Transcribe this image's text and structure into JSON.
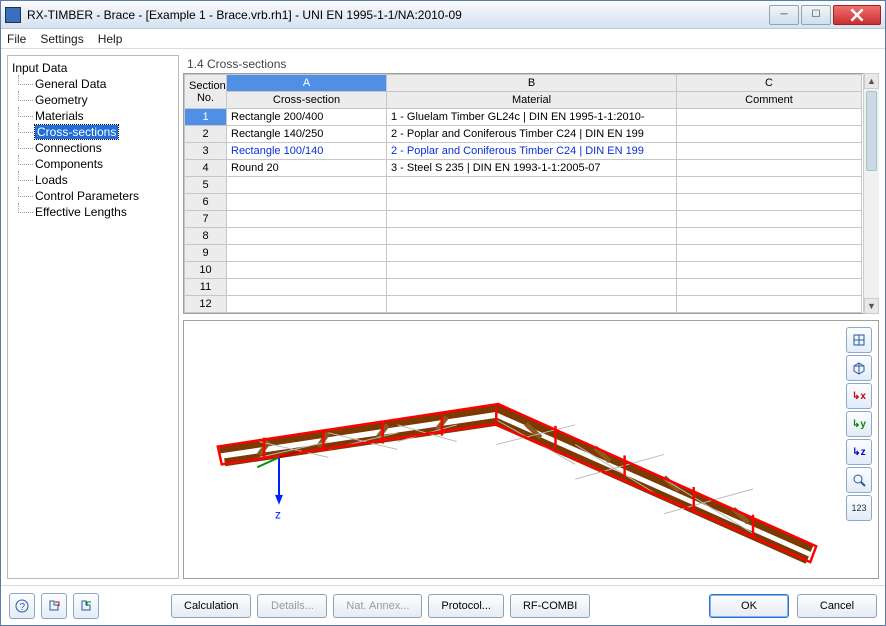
{
  "window": {
    "title": "RX-TIMBER - Brace - [Example 1 - Brace.vrb.rh1] - UNI EN 1995-1-1/NA:2010-09"
  },
  "menu": {
    "file": "File",
    "settings": "Settings",
    "help": "Help"
  },
  "tree": {
    "root": "Input Data",
    "items": [
      {
        "label": "General Data"
      },
      {
        "label": "Geometry"
      },
      {
        "label": "Materials"
      },
      {
        "label": "Cross-sections",
        "selected": true
      },
      {
        "label": "Connections"
      },
      {
        "label": "Components"
      },
      {
        "label": "Loads"
      },
      {
        "label": "Control Parameters"
      },
      {
        "label": "Effective Lengths"
      }
    ]
  },
  "panel": {
    "title": "1.4 Cross-sections"
  },
  "grid": {
    "letters": [
      "A",
      "B",
      "C"
    ],
    "section_no_header": "Section\nNo.",
    "col_headers": [
      "Cross-section",
      "Material",
      "Comment"
    ],
    "rows": [
      {
        "n": "1",
        "selected": true,
        "a": "Rectangle 200/400",
        "b": "1 - Gluelam Timber GL24c | DIN EN 1995-1-1:2010-",
        "c": ""
      },
      {
        "n": "2",
        "a": "Rectangle 140/250",
        "b": "2 - Poplar and Coniferous Timber C24 | DIN EN 199",
        "c": ""
      },
      {
        "n": "3",
        "blue": true,
        "a": "Rectangle 100/140",
        "b": "2 - Poplar and Coniferous Timber C24 | DIN EN 199",
        "c": ""
      },
      {
        "n": "4",
        "a": "Round 20",
        "b": "3 - Steel S 235 | DIN EN 1993-1-1:2005-07",
        "c": ""
      },
      {
        "n": "5",
        "a": "",
        "b": "",
        "c": ""
      },
      {
        "n": "6",
        "a": "",
        "b": "",
        "c": ""
      },
      {
        "n": "7",
        "a": "",
        "b": "",
        "c": ""
      },
      {
        "n": "8",
        "a": "",
        "b": "",
        "c": ""
      },
      {
        "n": "9",
        "a": "",
        "b": "",
        "c": ""
      },
      {
        "n": "10",
        "a": "",
        "b": "",
        "c": ""
      },
      {
        "n": "11",
        "a": "",
        "b": "",
        "c": ""
      },
      {
        "n": "12",
        "a": "",
        "b": "",
        "c": ""
      }
    ]
  },
  "viewer": {
    "axis_z": "z"
  },
  "buttons": {
    "calculation": "Calculation",
    "details": "Details...",
    "nat_annex": "Nat. Annex...",
    "protocol": "Protocol...",
    "rfcombi": "RF-COMBI",
    "ok": "OK",
    "cancel": "Cancel"
  },
  "toolbar_icons": {
    "b1": "grid",
    "b2": "cube",
    "b3": "ax-x",
    "b4": "ax-y",
    "b5": "ax-z",
    "b6": "find",
    "b7": "num"
  }
}
